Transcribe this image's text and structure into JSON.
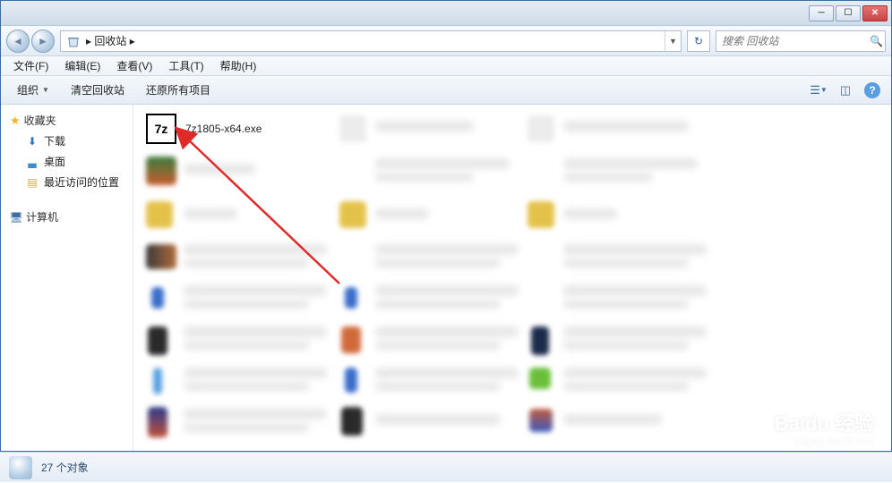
{
  "window": {
    "location_name": "回收站",
    "breadcrumb_sep": "▸"
  },
  "nav": {
    "search_placeholder": "搜索 回收站"
  },
  "menubar": {
    "file": "文件(F)",
    "edit": "编辑(E)",
    "view": "查看(V)",
    "tools": "工具(T)",
    "help": "帮助(H)"
  },
  "toolbar": {
    "organize": "组织",
    "empty": "清空回收站",
    "restore": "还原所有项目"
  },
  "sidebar": {
    "favorites": "收藏夹",
    "downloads": "下载",
    "desktop": "桌面",
    "recent": "最近访问的位置",
    "computer": "计算机"
  },
  "content": {
    "file1_name": "7z1805-x64.exe",
    "file1_icon_text": "7z"
  },
  "status": {
    "count_text": "27 个对象"
  },
  "watermark": {
    "brand": "Baidu 经验",
    "url": "jingyan.baidu.com"
  }
}
